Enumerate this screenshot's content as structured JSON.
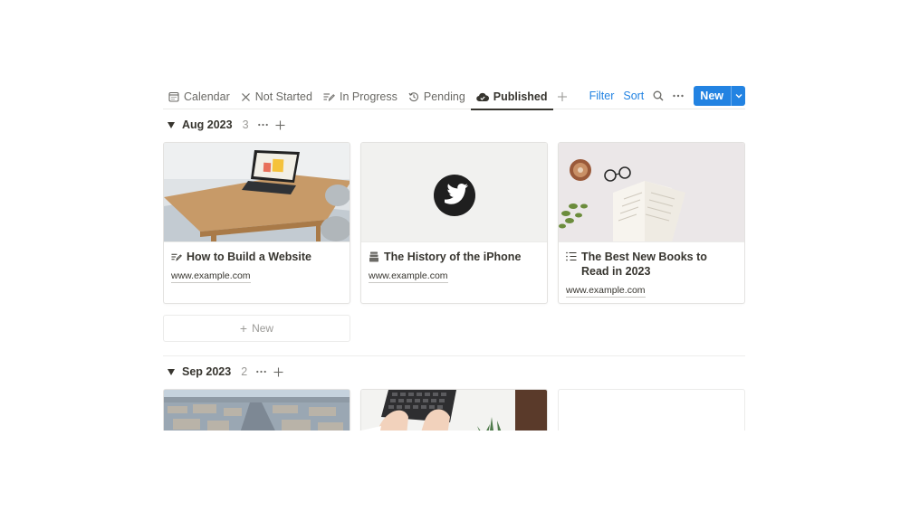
{
  "tabs": [
    {
      "label": "Calendar",
      "icon": "calendar-icon"
    },
    {
      "label": "Not Started",
      "icon": "x-icon"
    },
    {
      "label": "In Progress",
      "icon": "pencil-lines-icon"
    },
    {
      "label": "Pending",
      "icon": "history-icon"
    },
    {
      "label": "Published",
      "icon": "cloud-check-icon",
      "active": true
    }
  ],
  "actions": {
    "filter": "Filter",
    "sort": "Sort",
    "new": "New"
  },
  "groups": [
    {
      "title": "Aug 2023",
      "count": "3",
      "cards": [
        {
          "title": "How to Build a Website",
          "url": "www.example.com",
          "icon": "pencil-lines-icon",
          "image": "tablet-on-desk-photo"
        },
        {
          "title": "The History of the iPhone",
          "url": "www.example.com",
          "icon": "archive-stack-icon",
          "image": "twitter-logo"
        },
        {
          "title": "The Best New Books to Read in 2023",
          "url": "www.example.com",
          "icon": "list-icon",
          "image": "book-and-coffee-photo"
        }
      ],
      "add_new": "New"
    },
    {
      "title": "Sep 2023",
      "count": "2",
      "cards": [
        {
          "image": "city-aerial-photo"
        },
        {
          "image": "keyboard-typing-photo"
        }
      ]
    }
  ],
  "colors": {
    "accent": "#2383e2",
    "text": "#37352f",
    "muted": "#9b9a97"
  }
}
